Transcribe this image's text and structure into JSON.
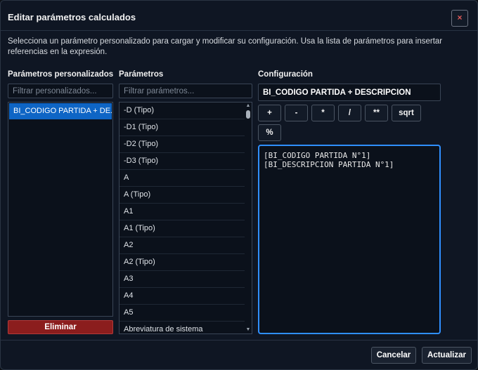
{
  "dialog": {
    "title": "Editar parámetros calculados",
    "close_label": "×",
    "description": "Selecciona un parámetro personalizado para cargar y modificar su configuración. Usa la lista de parámetros para insertar referencias en la expresión."
  },
  "custom_params": {
    "title": "Parámetros personalizados",
    "filter_placeholder": "Filtrar personalizados...",
    "items": [
      "BI_CODIGO PARTIDA + DE..."
    ],
    "delete_label": "Eliminar"
  },
  "params": {
    "title": "Parámetros",
    "filter_placeholder": "Filtrar parámetros...",
    "items": [
      "-D (Tipo)",
      "-D1 (Tipo)",
      "-D2 (Tipo)",
      "-D3 (Tipo)",
      "A",
      "A (Tipo)",
      "A1",
      "A1 (Tipo)",
      "A2",
      "A2 (Tipo)",
      "A3",
      "A4",
      "A5",
      "Abreviatura de sistema"
    ]
  },
  "config": {
    "title": "Configuración",
    "name_value": "BI_CODIGO PARTIDA + DESCRIPCION",
    "operators": [
      "+",
      "-",
      "*",
      "/",
      "**",
      "sqrt",
      "%"
    ],
    "expression_lines": [
      "[BI_CODIGO PARTIDA N°1]",
      "[BI_DESCRIPCION PARTIDA N°1]"
    ]
  },
  "footer": {
    "cancel_label": "Cancelar",
    "update_label": "Actualizar"
  },
  "colors": {
    "accent": "#2f8fff",
    "selection": "#0e65c5",
    "danger": "#8b1d1d",
    "background": "#0f1623"
  }
}
